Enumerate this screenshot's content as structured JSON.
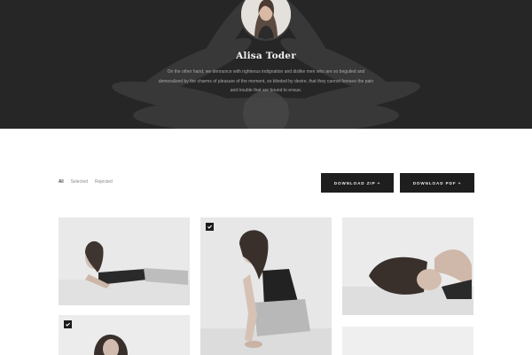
{
  "profile": {
    "name": "Alisa Toder",
    "bio_lines": [
      "On the other hand, we denounce with righteous indignation and dislike men who are so beguiled and",
      "demoralized by the charms of pleasure of the moment, so blinded by desire, that they cannot foresee the pain",
      "and trouble that are bound to ensue."
    ]
  },
  "filters": [
    {
      "label": "All",
      "active": true
    },
    {
      "label": "Selected",
      "active": false
    },
    {
      "label": "Rejected",
      "active": false
    }
  ],
  "actions": {
    "download_zip": "DOWNLOAD ZIP  +",
    "download_pdf": "DOWNLOAD PDF  +"
  },
  "gallery": [
    {
      "id": "photo-1",
      "selected": false
    },
    {
      "id": "photo-2",
      "selected": true
    },
    {
      "id": "photo-3",
      "selected": false
    },
    {
      "id": "photo-4",
      "selected": true
    },
    {
      "id": "photo-5",
      "selected": false
    }
  ],
  "icons": {
    "check": "check-icon",
    "plus": "plus-icon"
  }
}
